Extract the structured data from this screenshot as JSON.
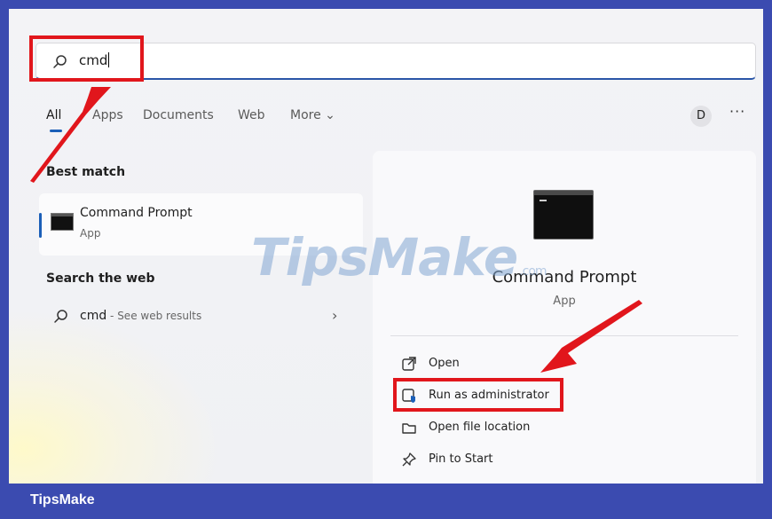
{
  "search": {
    "query": "cmd",
    "icon": "search-icon"
  },
  "tabs": [
    {
      "label": "All",
      "active": true
    },
    {
      "label": "Apps"
    },
    {
      "label": "Documents"
    },
    {
      "label": "Web"
    },
    {
      "label": "More ⌄"
    }
  ],
  "header": {
    "avatar_initial": "D",
    "more_label": "···"
  },
  "best_match": {
    "heading": "Best match",
    "title": "Command Prompt",
    "subtitle": "App"
  },
  "web": {
    "heading": "Search the web",
    "query": "cmd",
    "hint": " - See web results",
    "chevron": "›"
  },
  "details": {
    "title": "Command Prompt",
    "subtitle": "App",
    "actions": [
      {
        "label": "Open",
        "icon": "open-icon"
      },
      {
        "label": "Run as administrator",
        "icon": "shield-icon"
      },
      {
        "label": "Open file location",
        "icon": "folder-icon"
      },
      {
        "label": "Pin to Start",
        "icon": "pin-icon"
      }
    ]
  },
  "watermark": {
    "main": "TipsMake",
    "suffix": ".com"
  },
  "footer": {
    "brand": "TipsMake"
  },
  "colors": {
    "accent": "#1b5fb8",
    "frame": "#3b4bb0",
    "highlight": "#e1161c"
  }
}
